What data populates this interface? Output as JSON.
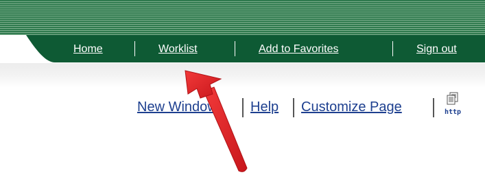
{
  "nav": {
    "items": [
      {
        "label": "Home"
      },
      {
        "label": "Worklist"
      },
      {
        "label": "Add to Favorites"
      },
      {
        "label": "Sign out"
      }
    ]
  },
  "utility": {
    "new_window": "New Window",
    "help": "Help",
    "customize_page": "Customize Page",
    "http_label": "http"
  },
  "colors": {
    "nav_bar": "#0e5a34",
    "banner": "#2f7a4e",
    "link": "#1d3f8f",
    "arrow": "#e8262a"
  },
  "icons": {
    "http_link": "http-link-icon",
    "arrow": "red-arrow-annotation"
  }
}
